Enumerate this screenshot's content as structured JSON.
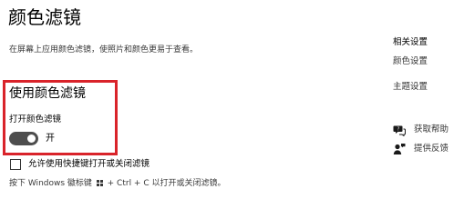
{
  "page": {
    "title": "颜色滤镜",
    "description": "在屏幕上应用颜色滤镜，使照片和颜色更易于查看。"
  },
  "color_filter": {
    "heading": "使用颜色滤镜",
    "toggle_label": "打开颜色滤镜",
    "toggle_state": "开",
    "toggle_on": true
  },
  "shortcut": {
    "checkbox_label": "允许使用快捷键打开或关闭滤镜",
    "checked": false,
    "hint_before": "按下 Windows 徽标键",
    "hint_after": "+ Ctrl + C 以打开或关闭滤镜。"
  },
  "related": {
    "heading": "相关设置",
    "links": [
      "颜色设置",
      "主题设置"
    ]
  },
  "help": {
    "get_help": "获取帮助",
    "feedback": "提供反馈"
  },
  "colors": {
    "highlight_border": "#d9232a",
    "toggle_on_bg": "#4d4d4d"
  }
}
